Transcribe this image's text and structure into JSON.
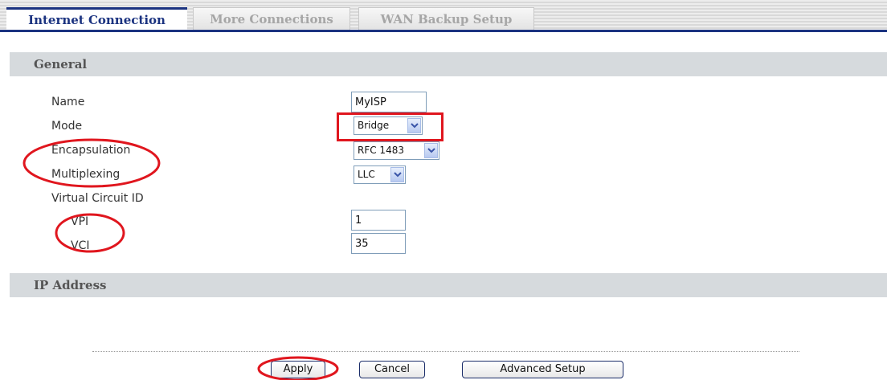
{
  "tabs": [
    {
      "label": "Internet Connection",
      "active": true
    },
    {
      "label": "More Connections",
      "active": false
    },
    {
      "label": "WAN Backup Setup",
      "active": false
    }
  ],
  "sections": {
    "general": "General",
    "ip_address": "IP Address"
  },
  "form": {
    "name_label": "Name",
    "name_value": "MyISP",
    "mode_label": "Mode",
    "mode_value": "Bridge",
    "encapsulation_label": "Encapsulation",
    "encapsulation_value": "RFC 1483",
    "multiplexing_label": "Multiplexing",
    "multiplexing_value": "LLC",
    "virtual_circuit_label": "Virtual Circuit ID",
    "vpi_label": "VPI",
    "vpi_value": "1",
    "vci_label": "VCI",
    "vci_value": "35"
  },
  "buttons": {
    "apply": "Apply",
    "cancel": "Cancel",
    "advanced": "Advanced Setup"
  },
  "colors": {
    "accent": "#1b3380",
    "annotation": "#e0161e",
    "section_bg": "#d6dadd"
  },
  "icons": {
    "dropdown": "chevron-down-icon"
  }
}
